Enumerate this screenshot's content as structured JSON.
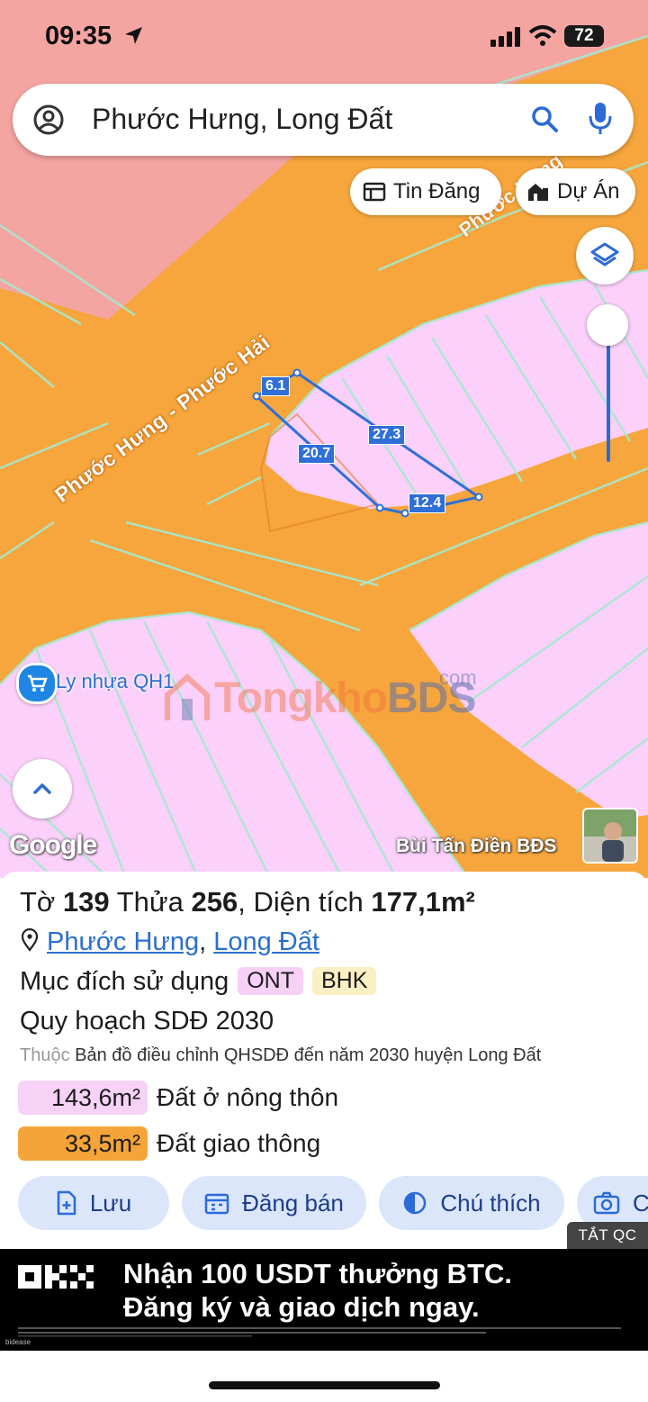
{
  "status_bar": {
    "time": "09:35",
    "battery": "72"
  },
  "search": {
    "query": "Phước Hưng, Long Đất"
  },
  "chips": {
    "listings": "Tin Đăng",
    "projects": "Dự Án"
  },
  "map": {
    "road_label": "Phước Hưng - Phước Hải",
    "road_label_2": "Phước Hưng",
    "dimensions": {
      "top": "6.1",
      "right": "27.3",
      "left": "20.7",
      "bottom": "12.4"
    },
    "poi_label": "Ly nhựa QH1",
    "watermark_main": "Tongkho",
    "watermark_bds": "BDS",
    "watermark_com": "com",
    "attribution": "Google",
    "credit": "Bùi Tấn Điền BĐS"
  },
  "parcel": {
    "sheet_label": "Tờ",
    "sheet_no": "139",
    "plot_label": "Thửa",
    "plot_no": "256",
    "area_label": ", Diện tích",
    "area": "177,1m²",
    "ward": "Phước Hưng",
    "district": "Long Đất",
    "purpose_label": "Mục đích sử dụng",
    "purpose_tags": [
      "ONT",
      "BHK"
    ],
    "plan_label": "Quy hoạch SDĐ 2030",
    "under_prefix": "Thuộc",
    "under_text": "Bản đồ điều chỉnh QHSDĐ đến năm 2030 huyện Long Đất",
    "zones": [
      {
        "area": "143,6m²",
        "label": "Đất ở nông thôn",
        "color": "#f7d2f7"
      },
      {
        "area": "33,5m²",
        "label": "Đất giao thông",
        "color": "#f5a43a"
      }
    ]
  },
  "actions": {
    "save": "Lưu",
    "post_sale": "Đăng bán",
    "legend": "Chú thích",
    "capture": "C"
  },
  "ad": {
    "close_label": "TẮT QC",
    "brand": "OKX",
    "line1": "Nhận 100 USDT thưởng BTC.",
    "line2": "Đăng ký và giao dịch ngay.",
    "source": "bidease"
  },
  "colors": {
    "residential": "#fbd0fa",
    "traffic": "#f6a63c",
    "commercial": "#f4a3a3",
    "boundary": "#9fe6c9",
    "accent": "#2c6ad8"
  }
}
